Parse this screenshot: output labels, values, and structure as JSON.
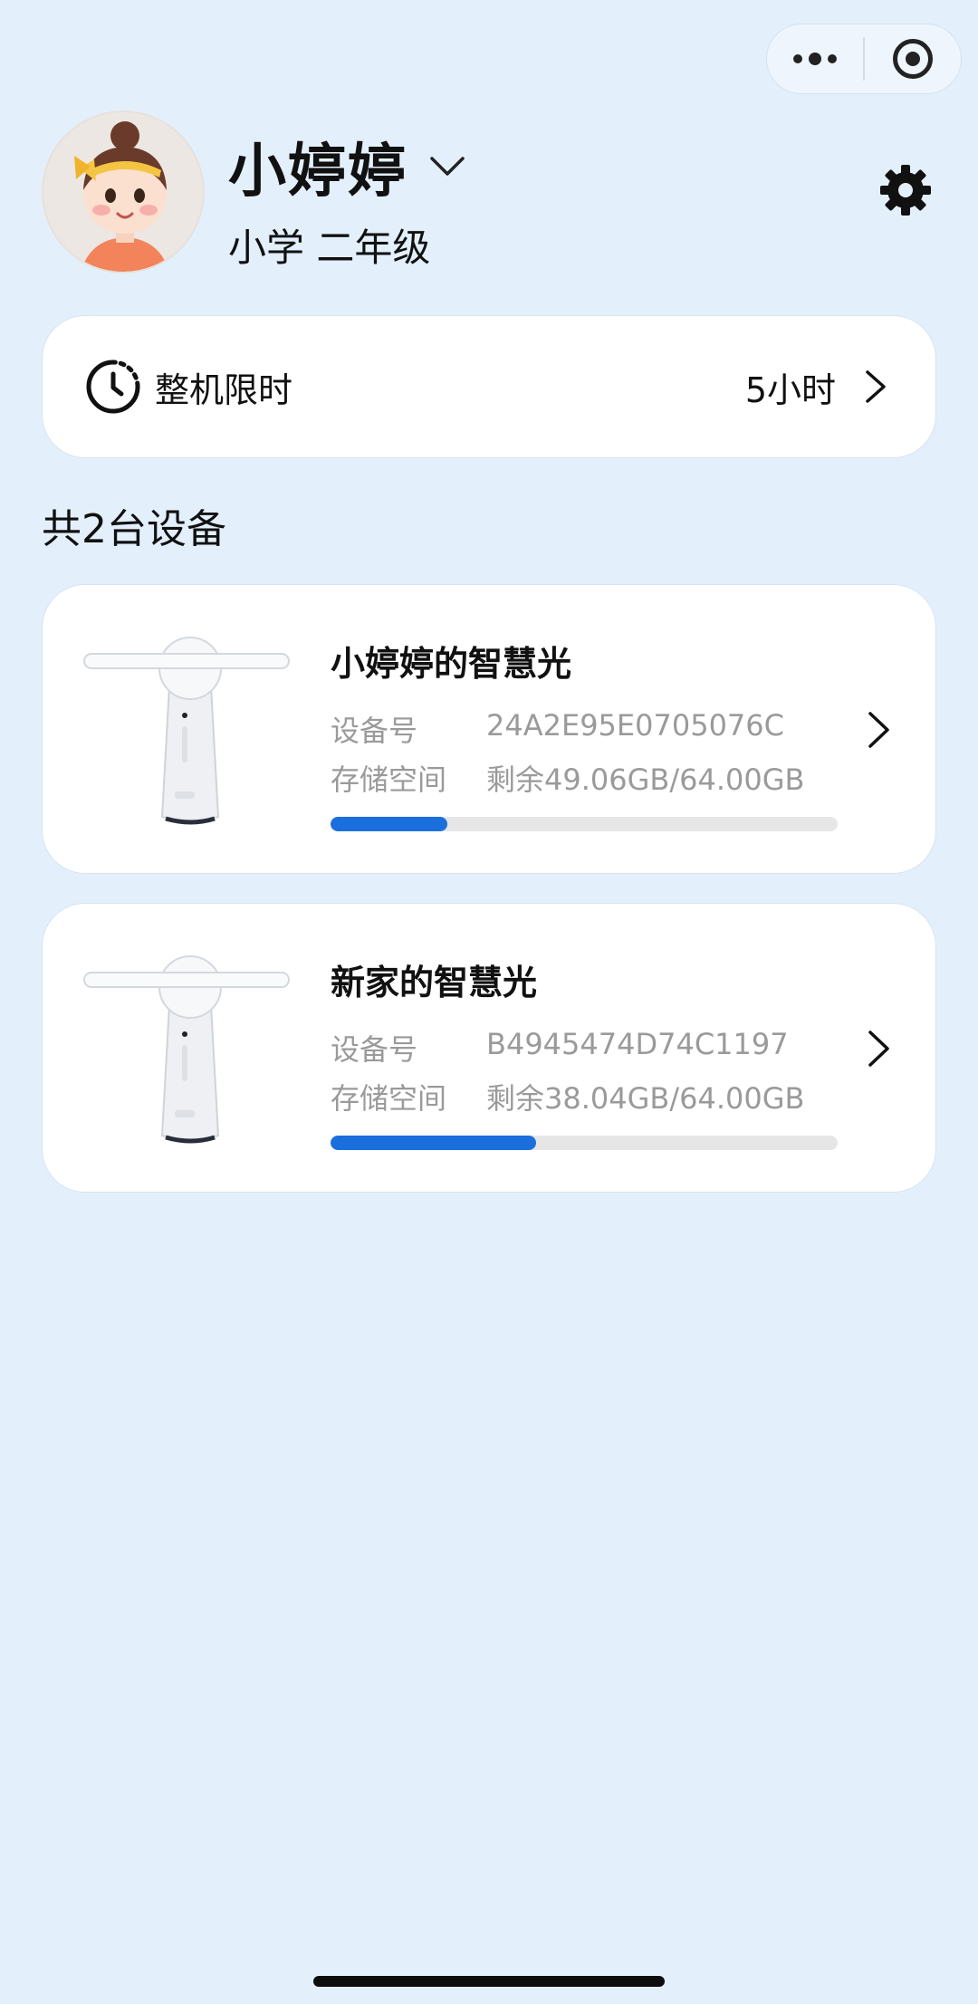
{
  "profile": {
    "name": "小婷婷",
    "grade": "小学 二年级"
  },
  "limit": {
    "label": "整机限时",
    "value": "5小时"
  },
  "devices_title": "共2台设备",
  "devices": [
    {
      "name": "小婷婷的智慧光",
      "id_label": "设备号",
      "id_value": "24A2E95E0705076C",
      "storage_label": "存储空间",
      "storage_value": "剩余49.06GB/64.00GB",
      "used_fraction": 0.23
    },
    {
      "name": "新家的智慧光",
      "id_label": "设备号",
      "id_value": "B4945474D74C1197",
      "storage_label": "存储空间",
      "storage_value": "剩余38.04GB/64.00GB",
      "used_fraction": 0.405
    }
  ],
  "colors": {
    "background": "#e3f0fc",
    "accent": "#1a6fdd",
    "track": "#e6e6e6"
  }
}
